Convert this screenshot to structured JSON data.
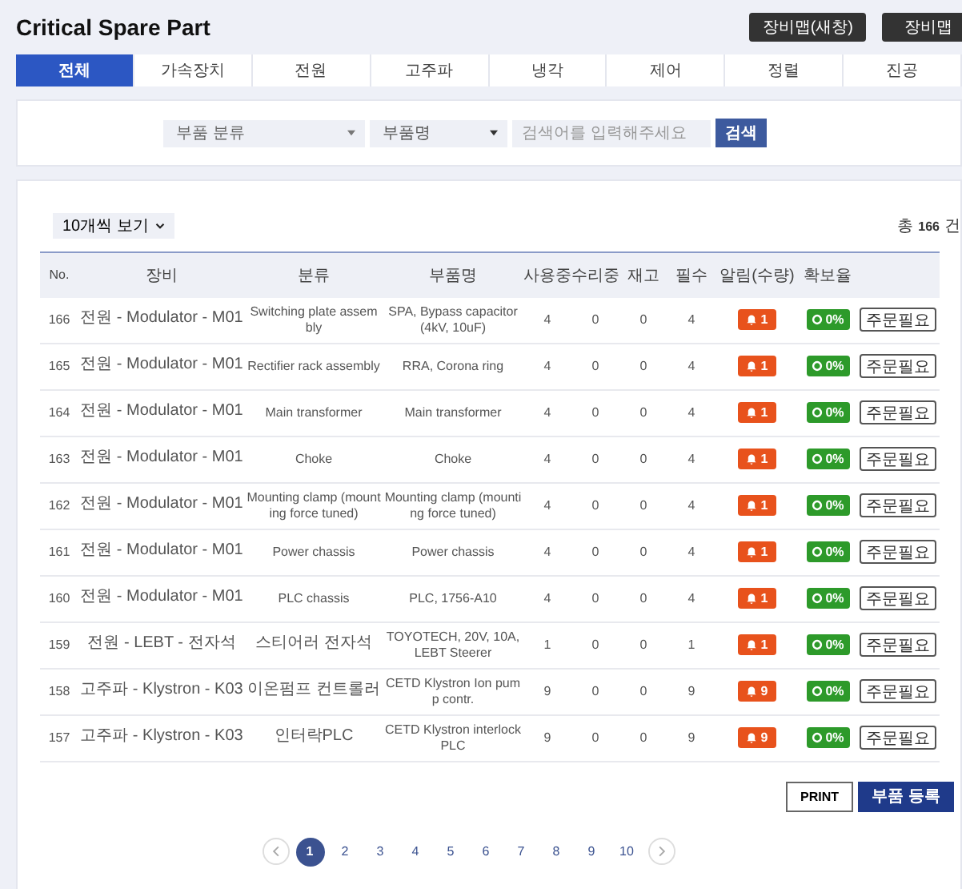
{
  "header": {
    "title": "Critical Spare Part",
    "buttons": [
      "장비맵(새창)",
      "장비맵"
    ]
  },
  "tabs": [
    {
      "label": "전체",
      "selected": true
    },
    {
      "label": "가속장치",
      "selected": false
    },
    {
      "label": "전원",
      "selected": false
    },
    {
      "label": "고주파",
      "selected": false
    },
    {
      "label": "냉각",
      "selected": false
    },
    {
      "label": "제어",
      "selected": false
    },
    {
      "label": "정렬",
      "selected": false
    },
    {
      "label": "진공",
      "selected": false
    }
  ],
  "search": {
    "category_select": "부품 분류",
    "part_select": "부품명",
    "placeholder": "검색어를 입력해주세요",
    "button": "검색"
  },
  "table": {
    "page_size": "10개씩 보기",
    "total_prefix": "총",
    "total": "166",
    "total_suffix": "건",
    "columns": [
      "No.",
      "장비",
      "분류",
      "부품명",
      "사용중",
      "수리중",
      "재고",
      "필수",
      "알림(수량)",
      "확보율"
    ],
    "rows": [
      {
        "no": "166",
        "equipment": "전원 - Modulator - M01",
        "category": "Switching plate assembly",
        "part": "SPA, Bypass capacitor (4kV, 10uF)",
        "in_use": "4",
        "repairing": "0",
        "stock": "0",
        "required": "4",
        "alarm": "1",
        "secured": "0%",
        "action": "주문필요"
      },
      {
        "no": "165",
        "equipment": "전원 - Modulator - M01",
        "category": "Rectifier rack assembly",
        "part": "RRA, Corona ring",
        "in_use": "4",
        "repairing": "0",
        "stock": "0",
        "required": "4",
        "alarm": "1",
        "secured": "0%",
        "action": "주문필요"
      },
      {
        "no": "164",
        "equipment": "전원 - Modulator - M01",
        "category": "Main transformer",
        "part": "Main transformer",
        "in_use": "4",
        "repairing": "0",
        "stock": "0",
        "required": "4",
        "alarm": "1",
        "secured": "0%",
        "action": "주문필요"
      },
      {
        "no": "163",
        "equipment": "전원 - Modulator - M01",
        "category": "Choke",
        "part": "Choke",
        "in_use": "4",
        "repairing": "0",
        "stock": "0",
        "required": "4",
        "alarm": "1",
        "secured": "0%",
        "action": "주문필요"
      },
      {
        "no": "162",
        "equipment": "전원 - Modulator - M01",
        "category": "Mounting clamp (mounting force tuned)",
        "part": "Mounting clamp (mounting force tuned)",
        "in_use": "4",
        "repairing": "0",
        "stock": "0",
        "required": "4",
        "alarm": "1",
        "secured": "0%",
        "action": "주문필요"
      },
      {
        "no": "161",
        "equipment": "전원 - Modulator - M01",
        "category": "Power chassis",
        "part": "Power chassis",
        "in_use": "4",
        "repairing": "0",
        "stock": "0",
        "required": "4",
        "alarm": "1",
        "secured": "0%",
        "action": "주문필요"
      },
      {
        "no": "160",
        "equipment": "전원 - Modulator - M01",
        "category": "PLC chassis",
        "part": "PLC, 1756-A10",
        "in_use": "4",
        "repairing": "0",
        "stock": "0",
        "required": "4",
        "alarm": "1",
        "secured": "0%",
        "action": "주문필요"
      },
      {
        "no": "159",
        "equipment": "전원 - LEBT - 전자석",
        "category": "스티어러 전자석",
        "part": "TOYOTECH, 20V, 10A, LEBT Steerer",
        "in_use": "1",
        "repairing": "0",
        "stock": "0",
        "required": "1",
        "alarm": "1",
        "secured": "0%",
        "action": "주문필요"
      },
      {
        "no": "158",
        "equipment": "고주파 - Klystron - K03",
        "category": "이온펌프 컨트롤러",
        "part": "CETD Klystron Ion pump contr.",
        "in_use": "9",
        "repairing": "0",
        "stock": "0",
        "required": "9",
        "alarm": "9",
        "secured": "0%",
        "action": "주문필요"
      },
      {
        "no": "157",
        "equipment": "고주파 - Klystron - K03",
        "category": "인터락PLC",
        "part": "CETD Klystron interlock PLC",
        "in_use": "9",
        "repairing": "0",
        "stock": "0",
        "required": "9",
        "alarm": "9",
        "secured": "0%",
        "action": "주문필요"
      }
    ]
  },
  "actions": [
    "PRINT",
    "부품 등록"
  ],
  "pagination": [
    {
      "label": "1",
      "selected": true
    },
    {
      "label": "2",
      "selected": false
    },
    {
      "label": "3",
      "selected": false
    },
    {
      "label": "4",
      "selected": false
    },
    {
      "label": "5",
      "selected": false
    },
    {
      "label": "6",
      "selected": false
    },
    {
      "label": "7",
      "selected": false
    },
    {
      "label": "8",
      "selected": false
    },
    {
      "label": "9",
      "selected": false
    },
    {
      "label": "10",
      "selected": false
    }
  ]
}
